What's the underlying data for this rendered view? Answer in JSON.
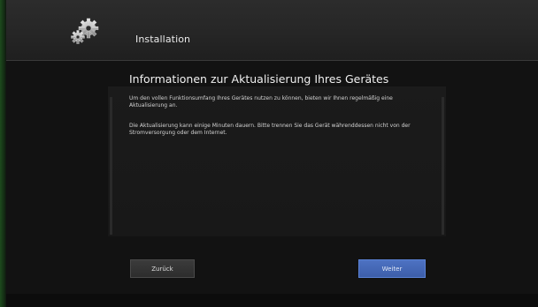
{
  "header": {
    "title": "Installation",
    "icon": "gear-icon"
  },
  "content": {
    "heading": "Informationen zur Aktualisierung Ihres Gerätes",
    "paragraph1": "Um den vollen Funktionsumfang Ihres Gerätes nutzen zu können, bieten wir Ihnen regelmäßig eine Aktualisierung an.",
    "paragraph2": "Die Aktualisierung kann einige Minuten dauern. Bitte trennen Sie das Gerät währenddessen nicht von der Stromversorgung oder dem Internet."
  },
  "buttons": {
    "back_label": "Zurück",
    "next_label": "Weiter"
  },
  "colors": {
    "accent": "#4a6fbf",
    "background": "#121212"
  }
}
